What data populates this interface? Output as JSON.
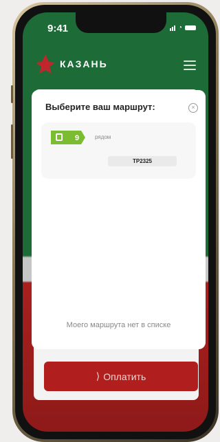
{
  "status_bar": {
    "time": "9:41"
  },
  "header": {
    "logo_text": "КАЗАНЬ"
  },
  "modal": {
    "title": "Выберите ваш маршрут:",
    "route": {
      "number": "9",
      "status": "рядом",
      "code": "ТР2325"
    },
    "not_listed_label": "Моего маршрута нет в списке"
  },
  "pay_button": {
    "label": "Оплатить"
  },
  "icons": {
    "logo": "kazan-logo-icon",
    "menu": "hamburger-menu-icon",
    "close": "close-icon",
    "bus": "trolleybus-icon",
    "pay": "nfc-icon"
  },
  "colors": {
    "brand_green": "#1d6b37",
    "brand_red": "#b01f1d",
    "route_green": "#7bbc32"
  }
}
